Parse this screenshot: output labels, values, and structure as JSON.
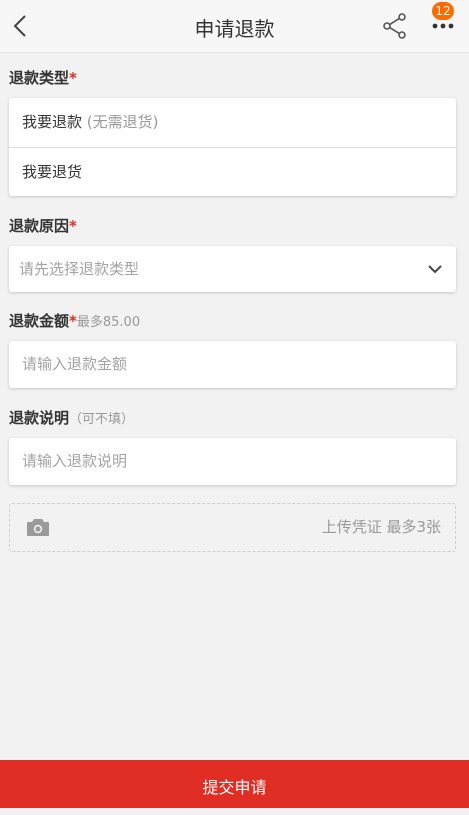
{
  "header": {
    "title": "申请退款",
    "badge_count": "12",
    "icons": [
      "back-arrow-icon",
      "share-icon",
      "more-icon"
    ]
  },
  "refund_type": {
    "label": "退款类型",
    "required_mark": "*",
    "options": [
      {
        "label": "我要退款",
        "sub": " (无需退货)"
      },
      {
        "label": "我要退货",
        "sub": ""
      }
    ]
  },
  "refund_reason": {
    "label": "退款原因",
    "required_mark": "*",
    "placeholder": "请先选择退款类型"
  },
  "refund_amount": {
    "label": "退款金额",
    "required_mark": "*",
    "hint": "最多85.00",
    "placeholder": "请输入退款金额"
  },
  "refund_note": {
    "label": "退款说明",
    "hint": "（可不填）",
    "placeholder": "请输入退款说明"
  },
  "upload": {
    "label": "上传凭证 最多3张"
  },
  "submit": {
    "label": "提交申请"
  },
  "colors": {
    "accent": "#e02e24",
    "badge": "#ff6a00",
    "background": "#f2f2f2"
  }
}
